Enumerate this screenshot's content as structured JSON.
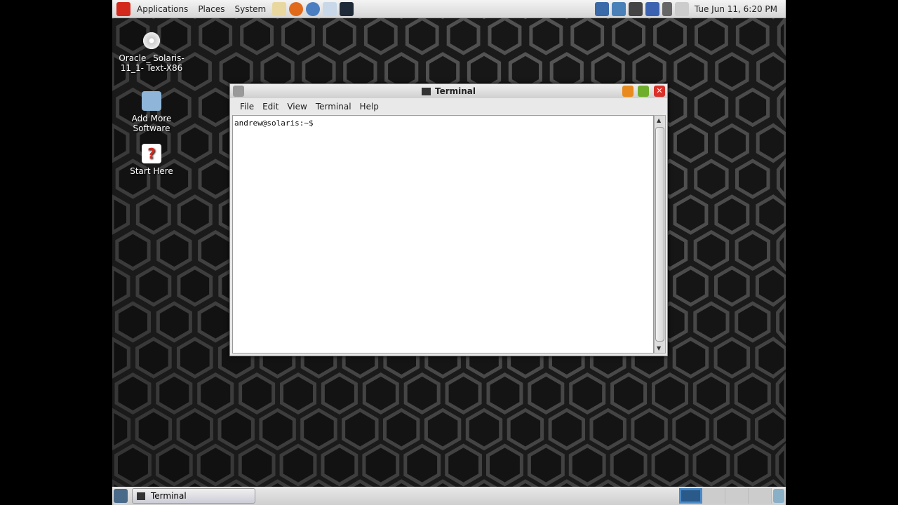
{
  "top_panel": {
    "menus": [
      "Applications",
      "Places",
      "System"
    ],
    "launchers": [
      "home-icon",
      "firefox-icon",
      "thunderbird-icon",
      "update-icon",
      "terminal-icon"
    ],
    "tray": [
      "system-monitor-icon",
      "network-icon",
      "clock-icon",
      "accessibility-icon",
      "volume-icon",
      "printer-icon"
    ],
    "clock": "Tue Jun 11,  6:20 PM"
  },
  "desktop_icons": [
    {
      "label": "Oracle_ Solaris-11_1- Text-X86",
      "icon": "cd-icon"
    },
    {
      "label": "Add More Software",
      "icon": "package-icon"
    },
    {
      "label": "Start Here",
      "icon": "help-icon"
    }
  ],
  "window": {
    "title": "Terminal",
    "menus": [
      "File",
      "Edit",
      "View",
      "Terminal",
      "Help"
    ],
    "prompt": "andrew@solaris:~$"
  },
  "bottom_panel": {
    "task": "Terminal",
    "workspaces": 4,
    "active_workspace": 1
  },
  "colors": {
    "accent_red": "#d42a1e",
    "close": "#d9322a",
    "minimize": "#e88a1e",
    "maximize": "#6fae2c"
  }
}
